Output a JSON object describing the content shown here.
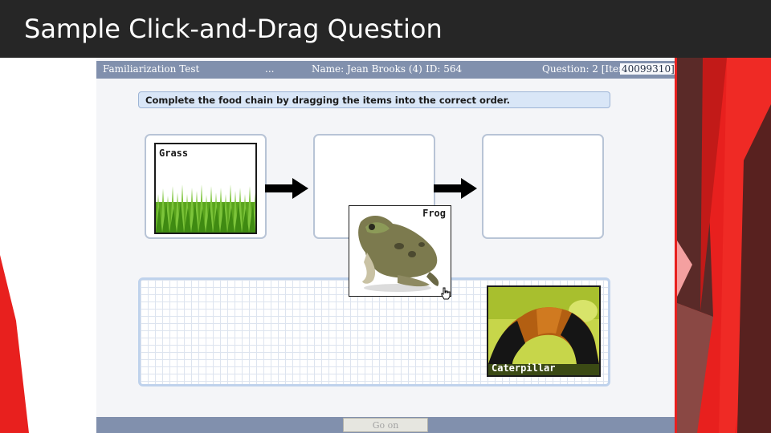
{
  "slide": {
    "title": "Sample Click-and-Drag Question"
  },
  "test_header": {
    "test_name": "Familiarization Test",
    "dots": "...",
    "student": "Name: Jean Brooks (4)",
    "id": "ID: 564",
    "question": "Question: 2 [Item",
    "item": "40099310]"
  },
  "instruction": "Complete the food chain by dragging the items into the correct order.",
  "items": {
    "grass": "Grass",
    "frog": "Frog",
    "caterpillar": "Caterpillar"
  },
  "footer": {
    "go_on_label": "Go on"
  },
  "colors": {
    "slide_bar": "#262626",
    "accent_red": "#e8201e",
    "header_blue": "#8190ad",
    "instruction_bg": "#d9e6f7"
  }
}
